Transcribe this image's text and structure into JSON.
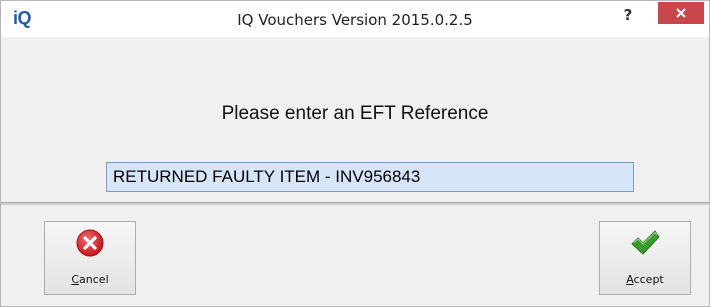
{
  "window": {
    "logo_text": "iQ",
    "title": "IQ Vouchers Version 2015.0.2.5",
    "help_label": "?",
    "close_label": "×"
  },
  "dialog": {
    "prompt": "Please enter an EFT Reference",
    "reference_value": "RETURNED FAULTY ITEM - INV956843"
  },
  "buttons": {
    "cancel": {
      "mnemonic": "C",
      "rest": "ancel",
      "icon": "error-cross-icon"
    },
    "accept": {
      "mnemonic": "A",
      "rest": "ccept",
      "icon": "green-check-icon"
    }
  },
  "colors": {
    "logo": "#1c5fa8",
    "close_button": "#c9474a",
    "input_background": "#d6e6f8",
    "cancel_icon": "#d9262b",
    "accept_icon": "#3a9a2e"
  }
}
